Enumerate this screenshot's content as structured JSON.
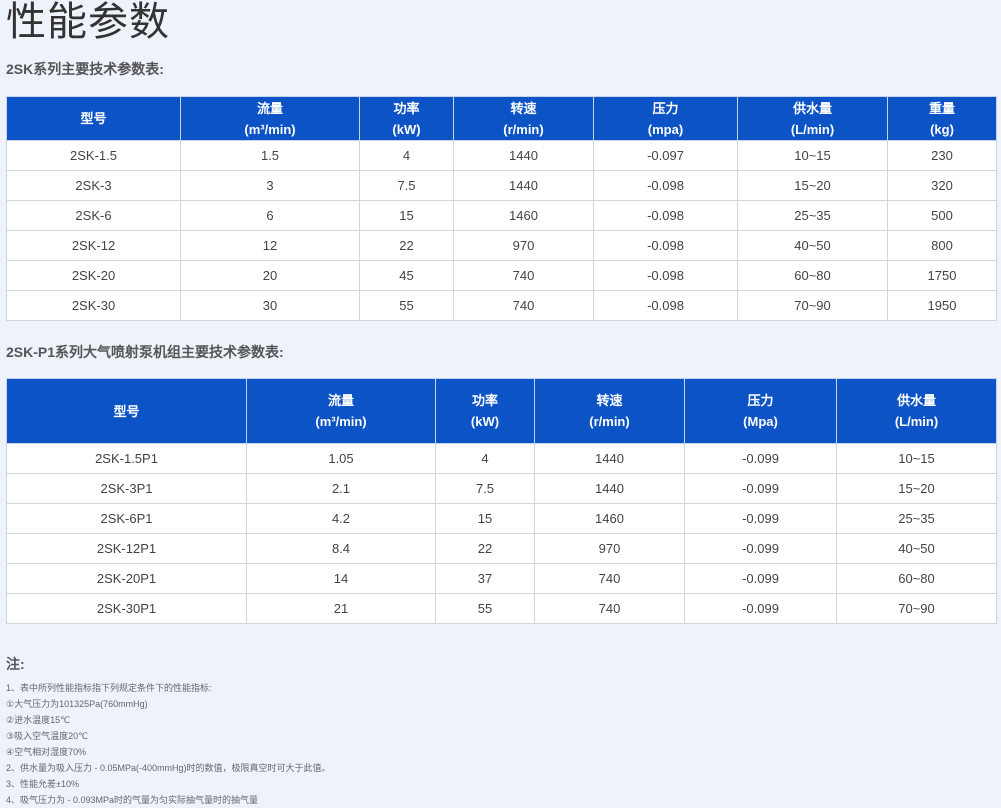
{
  "page_title": "性能参数",
  "table1": {
    "heading": "2SK系列主要技术参数表:",
    "headers": [
      {
        "name": "型号",
        "unit": ""
      },
      {
        "name": "流量",
        "unit": "(m³/min)"
      },
      {
        "name": "功率",
        "unit": "(kW)"
      },
      {
        "name": "转速",
        "unit": "(r/min)"
      },
      {
        "name": "压力",
        "unit": "(mpa)"
      },
      {
        "name": "供水量",
        "unit": "(L/min)"
      },
      {
        "name": "重量",
        "unit": "(kg)"
      }
    ],
    "rows": [
      [
        "2SK-1.5",
        "1.5",
        "4",
        "1440",
        "-0.097",
        "10~15",
        "230"
      ],
      [
        "2SK-3",
        "3",
        "7.5",
        "1440",
        "-0.098",
        "15~20",
        "320"
      ],
      [
        "2SK-6",
        "6",
        "15",
        "1460",
        "-0.098",
        "25~35",
        "500"
      ],
      [
        "2SK-12",
        "12",
        "22",
        "970",
        "-0.098",
        "40~50",
        "800"
      ],
      [
        "2SK-20",
        "20",
        "45",
        "740",
        "-0.098",
        "60~80",
        "1750"
      ],
      [
        "2SK-30",
        "30",
        "55",
        "740",
        "-0.098",
        "70~90",
        "1950"
      ]
    ]
  },
  "table2": {
    "heading": "2SK-P1系列大气喷射泵机组主要技术参数表:",
    "headers": [
      {
        "name": "型号",
        "unit": ""
      },
      {
        "name": "流量",
        "unit": "(m³/min)"
      },
      {
        "name": "功率",
        "unit": "(kW)"
      },
      {
        "name": "转速",
        "unit": "(r/min)"
      },
      {
        "name": "压力",
        "unit": "(Mpa)"
      },
      {
        "name": "供水量",
        "unit": "(L/min)"
      }
    ],
    "rows": [
      [
        "2SK-1.5P1",
        "1.05",
        "4",
        "1440",
        "-0.099",
        "10~15"
      ],
      [
        "2SK-3P1",
        "2.1",
        "7.5",
        "1440",
        "-0.099",
        "15~20"
      ],
      [
        "2SK-6P1",
        "4.2",
        "15",
        "1460",
        "-0.099",
        "25~35"
      ],
      [
        "2SK-12P1",
        "8.4",
        "22",
        "970",
        "-0.099",
        "40~50"
      ],
      [
        "2SK-20P1",
        "14",
        "37",
        "740",
        "-0.099",
        "60~80"
      ],
      [
        "2SK-30P1",
        "21",
        "55",
        "740",
        "-0.099",
        "70~90"
      ]
    ]
  },
  "notes": {
    "title": "注:",
    "lines": [
      "1、表中所列性能指标指下列规定条件下的性能指标:",
      "①大气压力为101325Pa(760mmHg)",
      "②进水温度15℃",
      "③吸入空气温度20℃",
      "④空气相对湿度70%",
      "2、供水量为吸入压力 - 0.05MPa(-400mmHg)时的数值，极限真空时可大于此值。",
      "3、性能允差±10%",
      "4、吸气压力为 - 0.093MPa时的气量为匀实际抽气量时的抽气量"
    ]
  }
}
